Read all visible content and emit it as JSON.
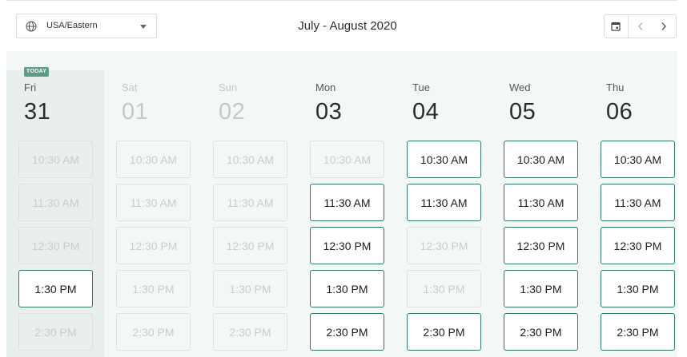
{
  "timezone": {
    "label": "USA/Eastern"
  },
  "range_title": "July - August 2020",
  "today_badge": "TODAY",
  "days": [
    {
      "name": "Fri",
      "num": "31",
      "muted": false,
      "slots": [
        {
          "label": "10:30 AM",
          "available": false
        },
        {
          "label": "11:30 AM",
          "available": false
        },
        {
          "label": "12:30 PM",
          "available": false
        },
        {
          "label": "1:30 PM",
          "available": true
        },
        {
          "label": "2:30 PM",
          "available": false
        }
      ]
    },
    {
      "name": "Sat",
      "num": "01",
      "muted": true,
      "slots": [
        {
          "label": "10:30 AM",
          "available": false
        },
        {
          "label": "11:30 AM",
          "available": false
        },
        {
          "label": "12:30 PM",
          "available": false
        },
        {
          "label": "1:30 PM",
          "available": false
        },
        {
          "label": "2:30 PM",
          "available": false
        }
      ]
    },
    {
      "name": "Sun",
      "num": "02",
      "muted": true,
      "slots": [
        {
          "label": "10:30 AM",
          "available": false
        },
        {
          "label": "11:30 AM",
          "available": false
        },
        {
          "label": "12:30 PM",
          "available": false
        },
        {
          "label": "1:30 PM",
          "available": false
        },
        {
          "label": "2:30 PM",
          "available": false
        }
      ]
    },
    {
      "name": "Mon",
      "num": "03",
      "muted": false,
      "slots": [
        {
          "label": "10:30 AM",
          "available": false
        },
        {
          "label": "11:30 AM",
          "available": true
        },
        {
          "label": "12:30 PM",
          "available": true
        },
        {
          "label": "1:30 PM",
          "available": true
        },
        {
          "label": "2:30 PM",
          "available": true
        }
      ]
    },
    {
      "name": "Tue",
      "num": "04",
      "muted": false,
      "slots": [
        {
          "label": "10:30 AM",
          "available": true
        },
        {
          "label": "11:30 AM",
          "available": true
        },
        {
          "label": "12:30 PM",
          "available": false
        },
        {
          "label": "1:30 PM",
          "available": false
        },
        {
          "label": "2:30 PM",
          "available": true
        }
      ]
    },
    {
      "name": "Wed",
      "num": "05",
      "muted": false,
      "slots": [
        {
          "label": "10:30 AM",
          "available": true
        },
        {
          "label": "11:30 AM",
          "available": true
        },
        {
          "label": "12:30 PM",
          "available": true
        },
        {
          "label": "1:30 PM",
          "available": true
        },
        {
          "label": "2:30 PM",
          "available": true
        }
      ]
    },
    {
      "name": "Thu",
      "num": "06",
      "muted": false,
      "slots": [
        {
          "label": "10:30 AM",
          "available": true
        },
        {
          "label": "11:30 AM",
          "available": true
        },
        {
          "label": "12:30 PM",
          "available": true
        },
        {
          "label": "1:30 PM",
          "available": true
        },
        {
          "label": "2:30 PM",
          "available": true
        }
      ]
    }
  ],
  "colors": {
    "accent": "#2f7a5f",
    "today_badge": "#5c9c84",
    "calendar_bg": "#f3f7f6",
    "today_column_bg": "#e9efec"
  },
  "icons": {
    "timezone": "globe-icon",
    "dropdown": "caret-down-icon",
    "calendar": "calendar-icon",
    "prev": "chevron-left-icon",
    "next": "chevron-right-icon"
  }
}
